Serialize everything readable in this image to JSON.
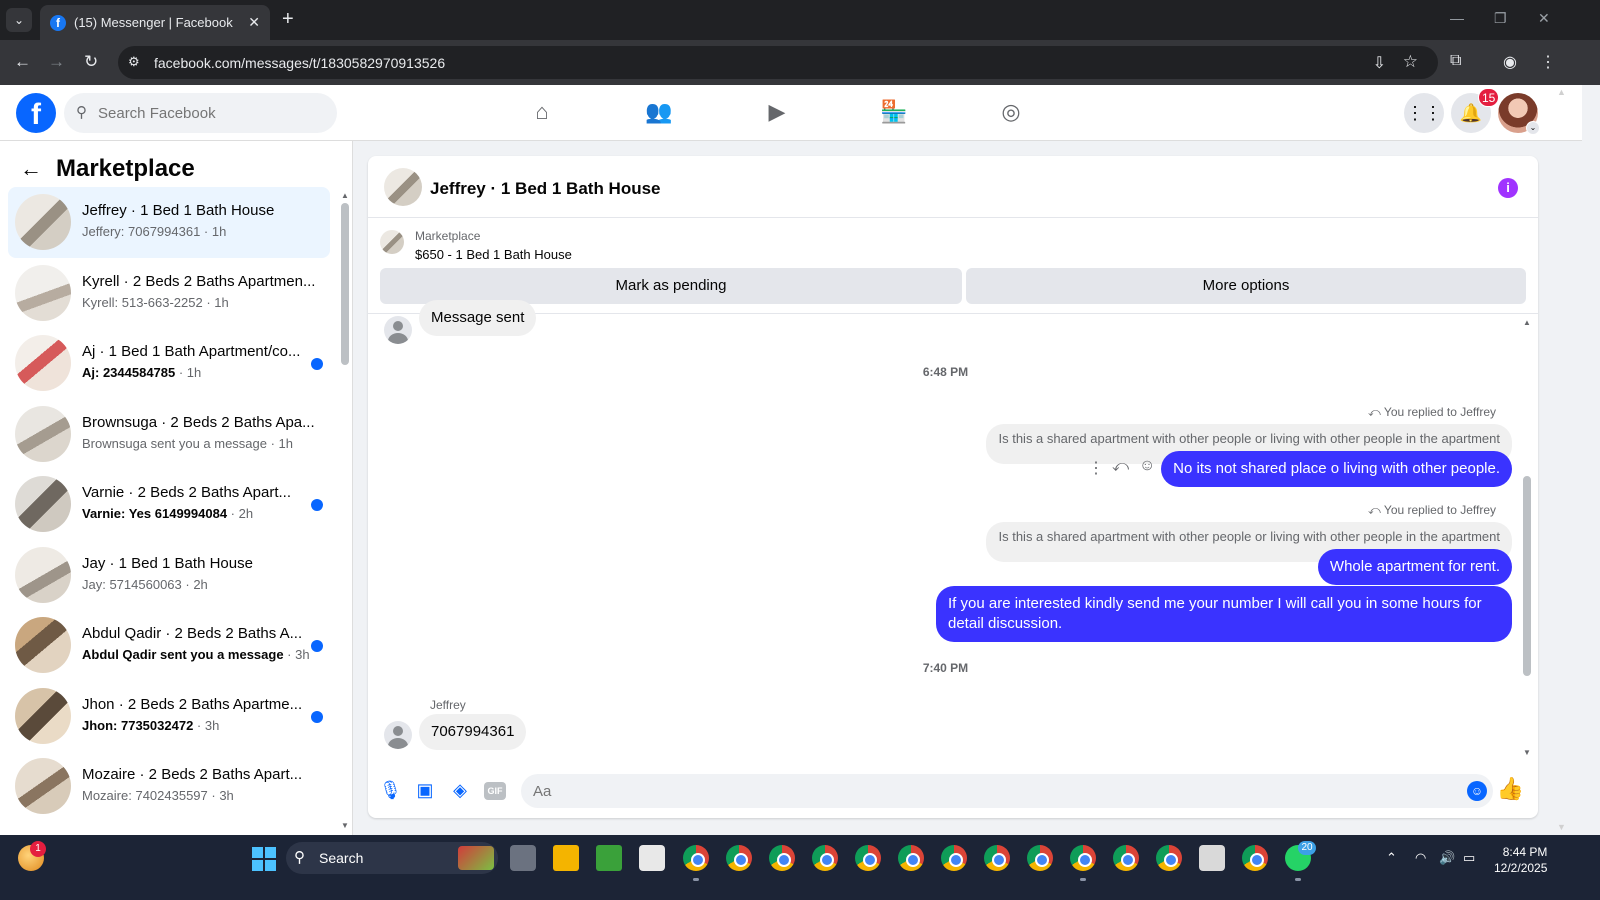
{
  "browser": {
    "tab_title": "(15) Messenger | Facebook",
    "tab_close": "✕",
    "new_tab": "+",
    "url": "facebook.com/messages/t/1830582970913526",
    "tab_dropdown": "⌄",
    "window_controls": {
      "minimize": "—",
      "maximize": "❐",
      "close": "✕"
    }
  },
  "facebook": {
    "search_placeholder": "Search Facebook",
    "notifications_count": "15",
    "nav_icons": [
      "home-icon",
      "friends-icon",
      "video-icon",
      "marketplace-icon",
      "groups-icon"
    ],
    "logo_letter": "f"
  },
  "sidebar": {
    "title": "Marketplace",
    "back": "←",
    "conversations": [
      {
        "name": "Jeffrey · 1 Bed 1 Bath House",
        "snippet": "Jeffery: 7067994361",
        "time": " · 1h",
        "unread": false,
        "active": true
      },
      {
        "name": "Kyrell · 2 Beds 2 Baths Apartmen...",
        "snippet": "Kyrell: 513-663-2252",
        "time": " · 1h",
        "unread": false,
        "active": false
      },
      {
        "name": "Aj · 1 Bed 1 Bath Apartment/co...",
        "snippet": "Aj: 2344584785",
        "time": " · 1h",
        "unread": true,
        "active": false
      },
      {
        "name": "Brownsuga · 2 Beds 2 Baths Apa...",
        "snippet": "Brownsuga sent you a message",
        "time": " · 1h",
        "unread": false,
        "active": false
      },
      {
        "name": "Varnie · 2 Beds 2 Baths Apart...",
        "snippet": "Varnie: Yes 6149994084",
        "time": " · 2h",
        "unread": true,
        "active": false
      },
      {
        "name": "Jay · 1 Bed 1 Bath House",
        "snippet": "Jay: 5714560063",
        "time": " · 2h",
        "unread": false,
        "active": false
      },
      {
        "name": "Abdul Qadir · 2 Beds 2 Baths A...",
        "snippet": "Abdul Qadir sent you a message",
        "time": " · 3h",
        "unread": true,
        "active": false
      },
      {
        "name": "Jhon · 2 Beds 2 Baths Apartme...",
        "snippet": "Jhon: 7735032472",
        "time": " · 3h",
        "unread": true,
        "active": false
      },
      {
        "name": "Mozaire · 2 Beds 2 Baths Apart...",
        "snippet": "Mozaire: 7402435597",
        "time": " · 3h",
        "unread": false,
        "active": false
      }
    ]
  },
  "chat": {
    "title": "Jeffrey · 1 Bed 1 Bath House",
    "info": "i",
    "marketplace_label": "Marketplace",
    "listing": "$650 - 1 Bed 1 Bath House",
    "mark_pending": "Mark as pending",
    "more_options": "More options",
    "messages": {
      "msg_sent": "Message sent",
      "time1": "6:48 PM",
      "replied1": "You replied to Jeffrey",
      "quote1": "Is this a shared apartment with other people or living with other people in the apartment",
      "reply1": "No its not shared place o living with other people.",
      "replied2": "You replied to Jeffrey",
      "quote2": "Is this a shared apartment with other people or living with other people in the apartment",
      "reply2": "Whole apartment for rent.",
      "reply3": "If you are interested kindly send me your number I will call you in some hours for detail discussion.",
      "time2": "7:40 PM",
      "sender": "Jeffrey",
      "incoming": "7067994361"
    },
    "composer_placeholder": "Aa",
    "gif": "GIF"
  },
  "taskbar": {
    "search": "Search",
    "weather_badge": "1",
    "whatsapp_badge": "20",
    "time": "8:44 PM",
    "date": "12/2/2025"
  },
  "colors": {
    "accent": "#0866ff",
    "outgoing_bubble": "#3a33ff",
    "unread_dot": "#0866ff"
  }
}
